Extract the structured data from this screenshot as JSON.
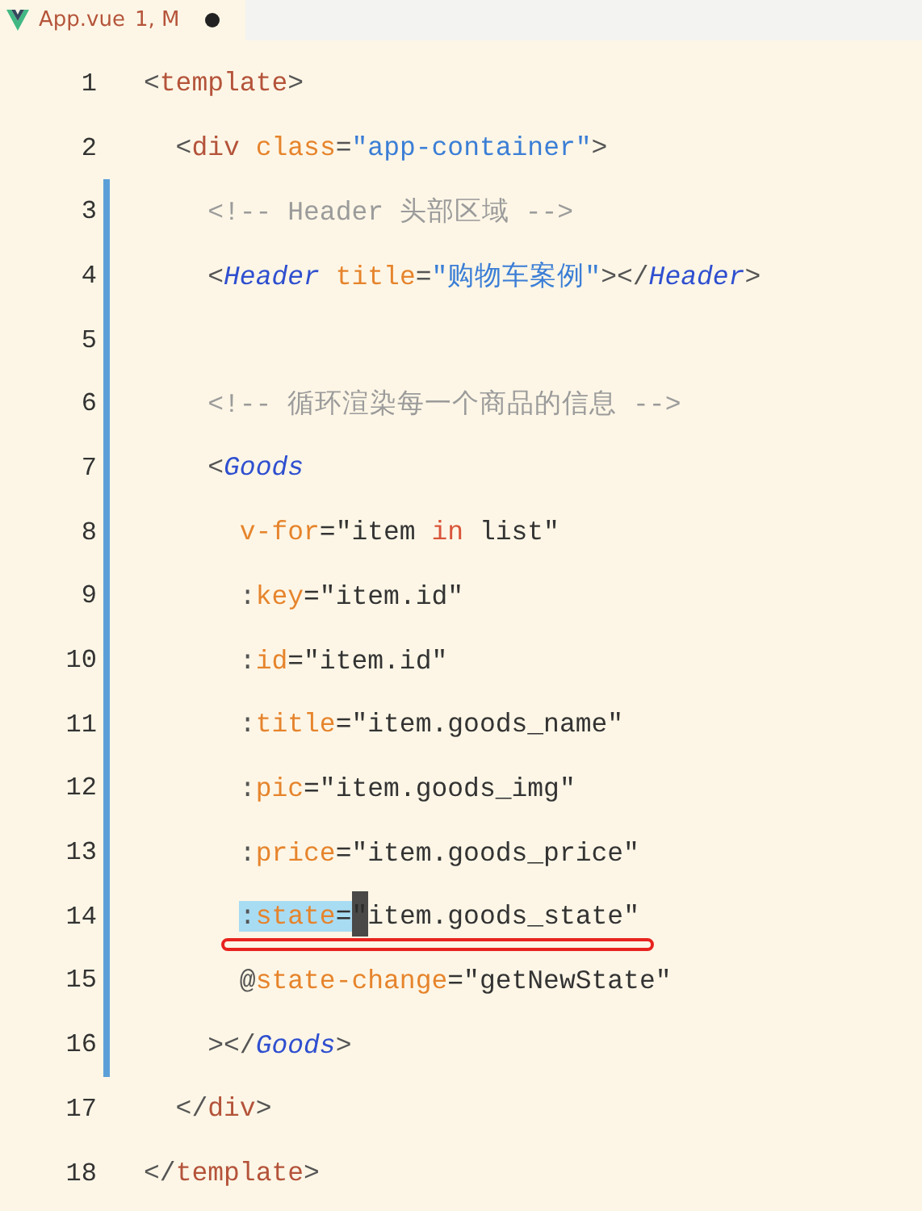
{
  "tab": {
    "filename": "App.vue",
    "status": "1, M",
    "unsaved": true
  },
  "lines": [
    {
      "number": "1",
      "modified": false,
      "underlined": false,
      "tokens": [
        {
          "kind": "punct",
          "text": "<"
        },
        {
          "kind": "tag",
          "text": "template"
        },
        {
          "kind": "punct",
          "text": ">"
        }
      ]
    },
    {
      "number": "2",
      "modified": false,
      "underlined": false,
      "tokens": [
        {
          "kind": "punct",
          "text": "  <"
        },
        {
          "kind": "tag",
          "text": "div"
        },
        {
          "kind": "attr",
          "text": " class"
        },
        {
          "kind": "punct",
          "text": "="
        },
        {
          "kind": "string",
          "text": "\"app-container\""
        },
        {
          "kind": "punct",
          "text": ">"
        }
      ]
    },
    {
      "number": "3",
      "modified": true,
      "underlined": false,
      "tokens": [
        {
          "kind": "comment",
          "text": "    <!-- Header 头部区域 -->"
        }
      ]
    },
    {
      "number": "4",
      "modified": true,
      "underlined": false,
      "tokens": [
        {
          "kind": "punct",
          "text": "    <"
        },
        {
          "kind": "component",
          "text": "Header"
        },
        {
          "kind": "attr",
          "text": " title"
        },
        {
          "kind": "punct",
          "text": "="
        },
        {
          "kind": "string",
          "text": "\"购物车案例\""
        },
        {
          "kind": "punct",
          "text": "></"
        },
        {
          "kind": "component",
          "text": "Header"
        },
        {
          "kind": "punct",
          "text": ">"
        }
      ]
    },
    {
      "number": "5",
      "modified": true,
      "underlined": false
    },
    {
      "number": "6",
      "modified": true,
      "underlined": false,
      "tokens": [
        {
          "kind": "comment",
          "text": "    <!-- 循环渲染每一个商品的信息 -->"
        }
      ]
    },
    {
      "number": "7",
      "modified": true,
      "underlined": false,
      "tokens": [
        {
          "kind": "punct",
          "text": "    <"
        },
        {
          "kind": "component",
          "text": "Goods"
        }
      ]
    },
    {
      "number": "8",
      "modified": true,
      "underlined": false,
      "tokens": [
        {
          "kind": "attr",
          "text": "      v-for"
        },
        {
          "kind": "expr",
          "text": "=\"item "
        },
        {
          "kind": "keyword",
          "text": "in"
        },
        {
          "kind": "expr",
          "text": " list\""
        }
      ]
    },
    {
      "number": "9",
      "modified": true,
      "underlined": false,
      "tokens": [
        {
          "kind": "punct",
          "text": "      :"
        },
        {
          "kind": "attr",
          "text": "key"
        },
        {
          "kind": "expr",
          "text": "=\"item.id\""
        }
      ]
    },
    {
      "number": "10",
      "modified": true,
      "underlined": false,
      "tokens": [
        {
          "kind": "punct",
          "text": "      :"
        },
        {
          "kind": "attr",
          "text": "id"
        },
        {
          "kind": "expr",
          "text": "=\"item.id\""
        }
      ]
    },
    {
      "number": "11",
      "modified": true,
      "underlined": false,
      "tokens": [
        {
          "kind": "punct",
          "text": "      :"
        },
        {
          "kind": "attr",
          "text": "title"
        },
        {
          "kind": "expr",
          "text": "=\"item.goods_name\""
        }
      ]
    },
    {
      "number": "12",
      "modified": true,
      "underlined": false,
      "tokens": [
        {
          "kind": "punct",
          "text": "      :"
        },
        {
          "kind": "attr",
          "text": "pic"
        },
        {
          "kind": "expr",
          "text": "=\"item.goods_img\""
        }
      ]
    },
    {
      "number": "13",
      "modified": true,
      "underlined": false,
      "tokens": [
        {
          "kind": "punct",
          "text": "      :"
        },
        {
          "kind": "attr",
          "text": "price"
        },
        {
          "kind": "expr",
          "text": "=\"item.goods_price\""
        }
      ]
    },
    {
      "number": "14",
      "modified": true,
      "underlined": true,
      "cursor": true,
      "tokens": [
        {
          "kind": "punct",
          "text": "      :",
          "highlighted": true
        },
        {
          "kind": "attr",
          "text": "state",
          "highlighted": true
        },
        {
          "kind": "expr",
          "text": "=",
          "highlighted": true
        },
        {
          "kind": "expr",
          "text": "\"item.goods_state\"",
          "highlighted": false
        }
      ]
    },
    {
      "number": "15",
      "modified": true,
      "underlined": false,
      "tokens": [
        {
          "kind": "punct",
          "text": "      @"
        },
        {
          "kind": "attr",
          "text": "state-change"
        },
        {
          "kind": "expr",
          "text": "=\"getNewState\""
        }
      ]
    },
    {
      "number": "16",
      "modified": true,
      "underlined": false,
      "tokens": [
        {
          "kind": "punct",
          "text": "    ></"
        },
        {
          "kind": "component",
          "text": "Goods"
        },
        {
          "kind": "punct",
          "text": ">"
        }
      ]
    },
    {
      "number": "17",
      "modified": false,
      "underlined": false,
      "tokens": [
        {
          "kind": "punct",
          "text": "  </"
        },
        {
          "kind": "tag",
          "text": "div"
        },
        {
          "kind": "punct",
          "text": ">"
        }
      ]
    },
    {
      "number": "18",
      "modified": false,
      "underlined": false,
      "tokens": [
        {
          "kind": "punct",
          "text": "</"
        },
        {
          "kind": "tag",
          "text": "template"
        },
        {
          "kind": "punct",
          "text": ">"
        }
      ]
    }
  ]
}
